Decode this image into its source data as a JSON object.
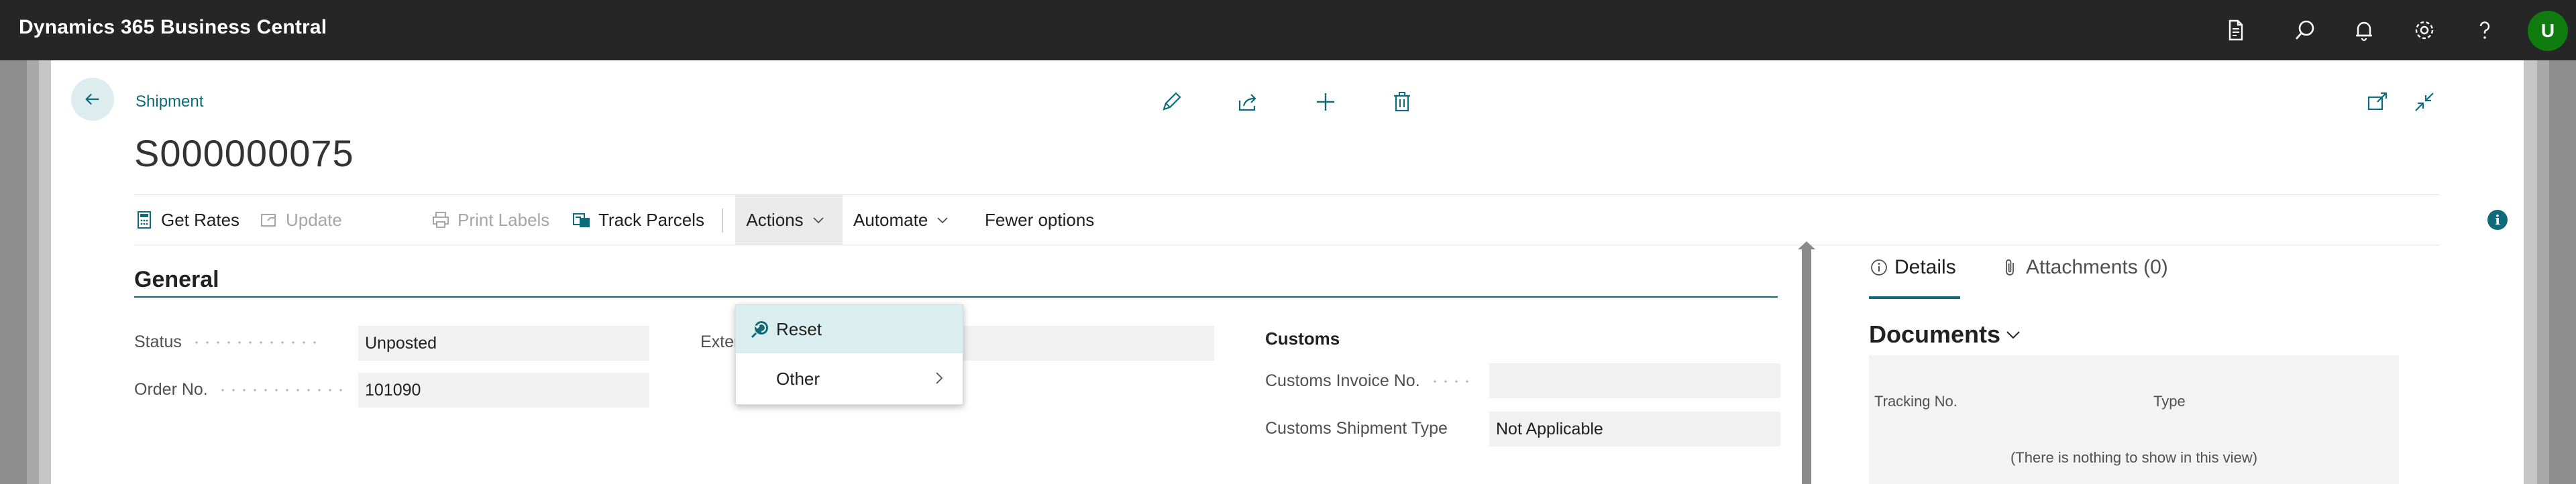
{
  "app": {
    "title": "Dynamics 365 Business Central",
    "user_initial": "U"
  },
  "topbar_icons": [
    "document-icon",
    "search-icon",
    "bell-icon",
    "gear-icon",
    "help-icon"
  ],
  "page": {
    "breadcrumb": "Shipment",
    "title": "S000000075"
  },
  "header_icons": [
    "edit-icon",
    "share-icon",
    "new-icon",
    "delete-icon",
    "open-new-window-icon",
    "collapse-icon"
  ],
  "actions": {
    "get_rates": "Get Rates",
    "update": "Update",
    "print_labels": "Print Labels",
    "track_parcels": "Track Parcels",
    "actions": "Actions",
    "automate": "Automate",
    "fewer_options": "Fewer options"
  },
  "menu": {
    "reset": "Reset",
    "other": "Other"
  },
  "general": {
    "title": "General",
    "status_label": "Status",
    "status_value": "Unposted",
    "order_no_label": "Order No.",
    "order_no_value": "101090",
    "external_doc_label": "External Document No.",
    "external_doc_value": "",
    "customs_title": "Customs",
    "customs_invoice_label": "Customs Invoice No.",
    "customs_invoice_value": "",
    "customs_shipment_type_label": "Customs Shipment Type",
    "customs_shipment_type_value": "Not Applicable"
  },
  "factbox": {
    "details_tab": "Details",
    "attachments_tab": "Attachments (0)",
    "documents_title": "Documents",
    "col_tracking": "Tracking No.",
    "col_type": "Type",
    "empty_text": "(There is nothing to show in this view)"
  },
  "colors": {
    "accent": "#0f6b7a",
    "topbar": "#262626",
    "avatar": "#107c10",
    "menu_highlight": "#daeef0"
  }
}
